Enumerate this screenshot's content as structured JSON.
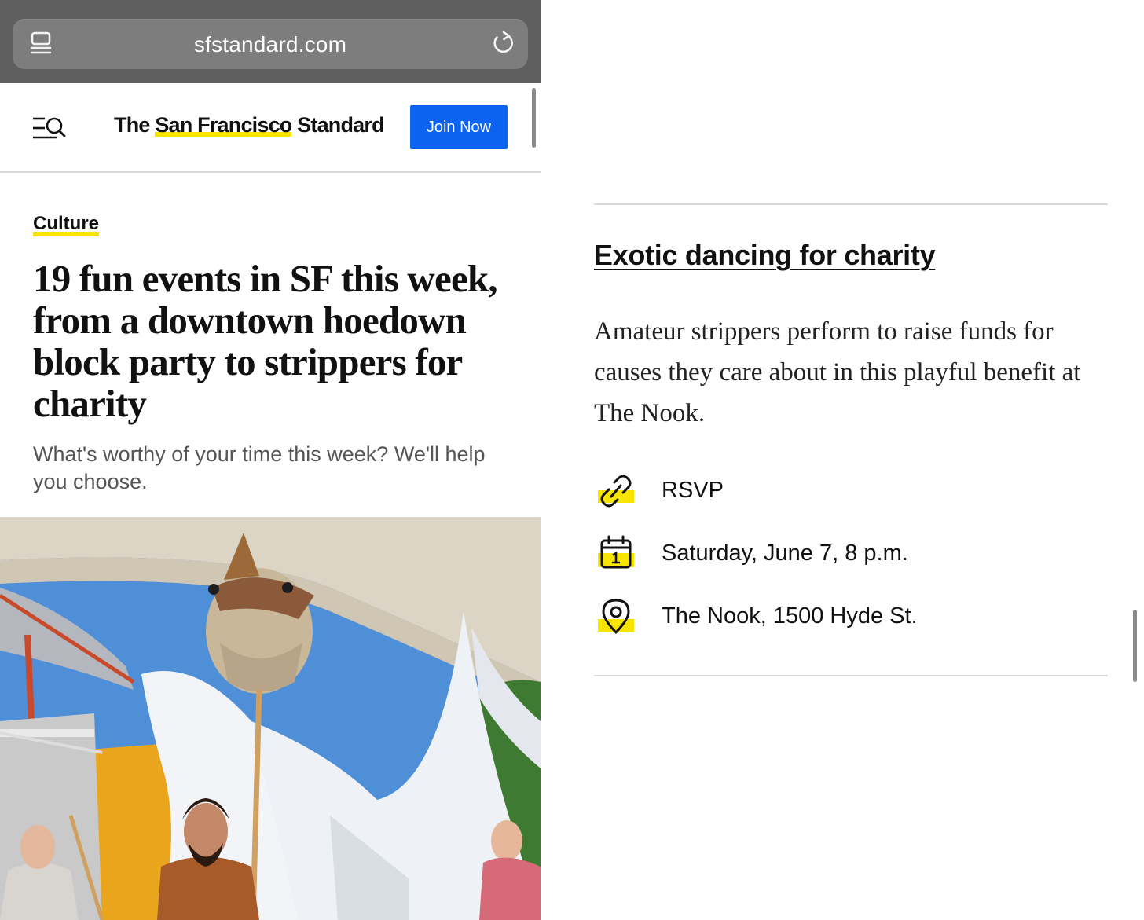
{
  "browser": {
    "url": "sfstandard.com"
  },
  "site_header": {
    "logo_part1": "The ",
    "logo_highlight": "San Francisco",
    "logo_part2": " Standard",
    "join_label": "Join Now"
  },
  "article": {
    "category": "Culture",
    "headline": "19 fun events in SF this week, from a downtown hoedown block party to strippers for charity",
    "dek": "What's worthy of your time this week? We'll help you choose."
  },
  "event": {
    "title": "Exotic dancing for charity",
    "description": "Amateur strippers perform to raise funds for causes they care about in this playful benefit at The Nook.",
    "rsvp_label": "RSVP",
    "date": "Saturday, June 7, 8 p.m.",
    "location": "The Nook, 1500 Hyde St."
  },
  "icons": {
    "tabs": "tabs-icon",
    "reload": "reload-icon",
    "menu_search": "menu-search-icon",
    "rsvp": "link-icon",
    "date": "calendar-icon",
    "location": "map-pin-icon"
  },
  "colors": {
    "accent_yellow": "#f7e400",
    "join_blue": "#0b63ef",
    "browser_chrome": "#5f5f5f",
    "text": "#111111",
    "muted": "#555555"
  }
}
